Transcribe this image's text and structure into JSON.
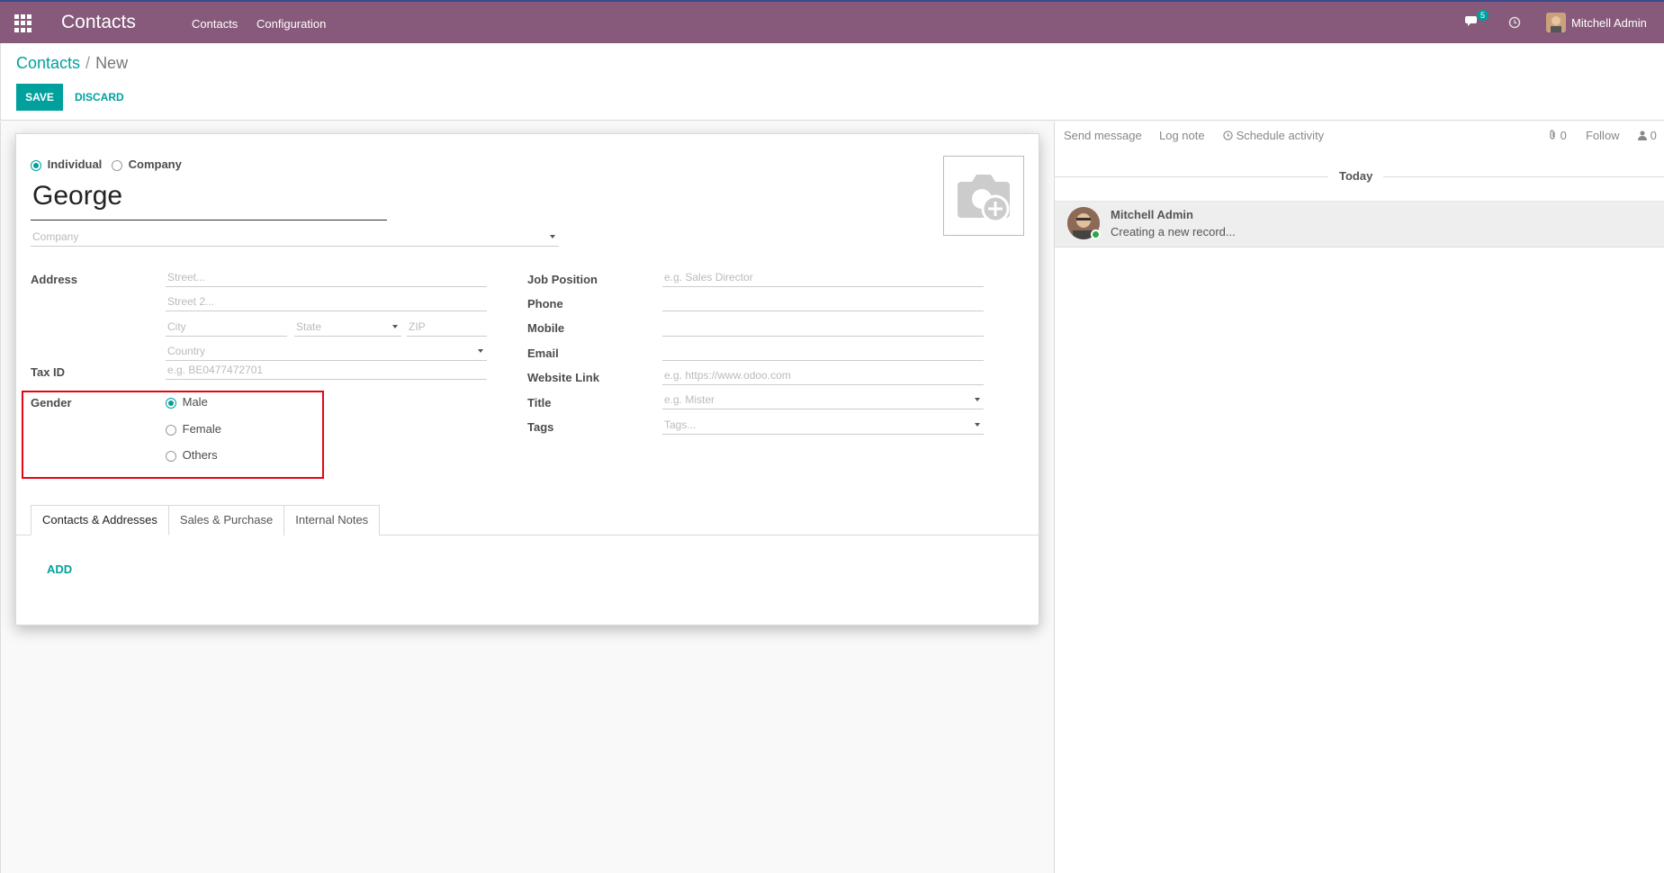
{
  "navbar": {
    "app_title": "Contacts",
    "menu": [
      "Contacts",
      "Configuration"
    ],
    "messages_badge": "5",
    "user_name": "Mitchell Admin"
  },
  "control_panel": {
    "breadcrumb_parent": "Contacts",
    "breadcrumb_separator": "/",
    "breadcrumb_current": "New",
    "save_label": "SAVE",
    "discard_label": "DISCARD"
  },
  "form": {
    "type_individual": "Individual",
    "type_company": "Company",
    "name_value": "George",
    "company_placeholder": "Company",
    "address_label": "Address",
    "street_placeholder": "Street...",
    "street2_placeholder": "Street 2...",
    "city_placeholder": "City",
    "state_placeholder": "State",
    "zip_placeholder": "ZIP",
    "country_placeholder": "Country",
    "taxid_label": "Tax ID",
    "taxid_placeholder": "e.g. BE0477472701",
    "gender_label": "Gender",
    "gender_options": [
      "Male",
      "Female",
      "Others"
    ],
    "gender_selected": "Male",
    "job_position_label": "Job Position",
    "job_position_placeholder": "e.g. Sales Director",
    "phone_label": "Phone",
    "mobile_label": "Mobile",
    "email_label": "Email",
    "website_label": "Website Link",
    "website_placeholder": "e.g. https://www.odoo.com",
    "title_label": "Title",
    "title_placeholder": "e.g. Mister",
    "tags_label": "Tags",
    "tags_placeholder": "Tags...",
    "tabs": [
      "Contacts & Addresses",
      "Sales & Purchase",
      "Internal Notes"
    ],
    "add_label": "ADD"
  },
  "chatter": {
    "send_message": "Send message",
    "log_note": "Log note",
    "schedule_activity": "Schedule activity",
    "attachments_count": "0",
    "follow": "Follow",
    "followers_count": "0",
    "today": "Today",
    "message_author": "Mitchell Admin",
    "message_body": "Creating a new record..."
  },
  "colors": {
    "navbar": "#875a7b",
    "accent": "#00a09d",
    "highlight_box": "#e30613"
  }
}
